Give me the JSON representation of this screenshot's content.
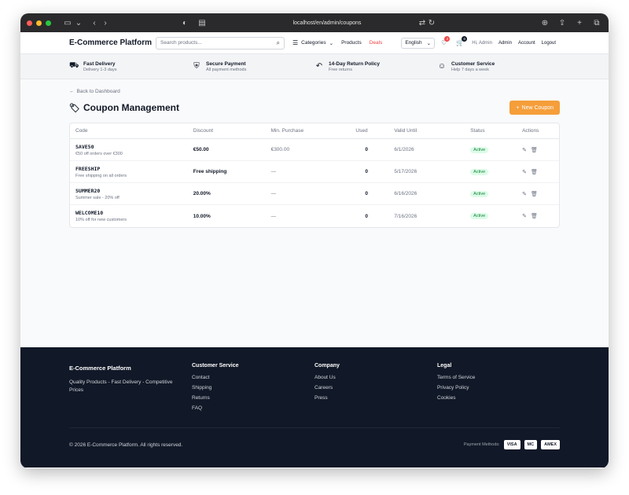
{
  "browser": {
    "url": "localhost/en/admin/coupons"
  },
  "header": {
    "brand": "E-Commerce Platform",
    "search_placeholder": "Search products...",
    "nav": {
      "categories": "Categories",
      "products": "Products",
      "deals": "Deals"
    },
    "language": "English",
    "wishlist_count": "3",
    "cart_count": "0",
    "greeting": "Hi, Admin",
    "admin": "Admin",
    "account": "Account",
    "logout": "Logout"
  },
  "features": [
    {
      "title": "Fast Delivery",
      "subtitle": "Delivery 1-3 days",
      "icon": "truck-icon"
    },
    {
      "title": "Secure Payment",
      "subtitle": "All payment methods",
      "icon": "shield-icon"
    },
    {
      "title": "14-Day Return Policy",
      "subtitle": "Free returns",
      "icon": "return-icon"
    },
    {
      "title": "Customer Service",
      "subtitle": "Help 7 days a week",
      "icon": "support-icon"
    }
  ],
  "main": {
    "back_link": "Back to Dashboard",
    "title": "Coupon Management",
    "new_button": "New Coupon",
    "columns": {
      "code": "Code",
      "discount": "Discount",
      "min_purchase": "Min. Purchase",
      "used": "Used",
      "valid_until": "Valid Until",
      "status": "Status",
      "actions": "Actions"
    },
    "coupons": [
      {
        "code": "SAVE50",
        "desc": "€50 off orders over €300",
        "discount": "€50.00",
        "min": "€300.00",
        "used": "0",
        "valid": "6/1/2026",
        "status": "Active"
      },
      {
        "code": "FREESHIP",
        "desc": "Free shipping on all orders",
        "discount": "Free shipping",
        "min": "—",
        "used": "0",
        "valid": "5/17/2026",
        "status": "Active"
      },
      {
        "code": "SUMMER20",
        "desc": "Summer sale - 20% off",
        "discount": "20.00%",
        "min": "—",
        "used": "0",
        "valid": "6/16/2026",
        "status": "Active"
      },
      {
        "code": "WELCOME10",
        "desc": "10% off for new customers",
        "discount": "10.00%",
        "min": "—",
        "used": "0",
        "valid": "7/16/2026",
        "status": "Active"
      }
    ]
  },
  "footer": {
    "brand": "E-Commerce Platform",
    "tagline": "Quality Products - Fast Delivery - Competitive Prices",
    "customer_service": {
      "title": "Customer Service",
      "links": [
        "Contact",
        "Shipping",
        "Returns",
        "FAQ"
      ]
    },
    "company": {
      "title": "Company",
      "links": [
        "About Us",
        "Careers",
        "Press"
      ]
    },
    "legal": {
      "title": "Legal",
      "links": [
        "Terms of Service",
        "Privacy Policy",
        "Cookies"
      ]
    },
    "copyright": "© 2026 E-Commerce Platform. All rights reserved.",
    "payment_label": "Payment Methods:",
    "payment_methods": [
      "VISA",
      "MC",
      "AMEX"
    ]
  },
  "colors": {
    "accent": "#f59e3a",
    "deals": "#ef4444",
    "footer_bg": "#111827",
    "status_bg": "#dcfce7",
    "status_text": "#15803d"
  }
}
